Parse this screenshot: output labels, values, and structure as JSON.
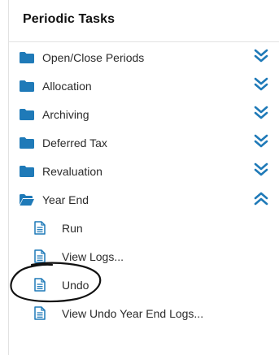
{
  "panel": {
    "title": "Periodic Tasks"
  },
  "colors": {
    "accent": "#1f7ab8",
    "text": "#2b2b2b"
  },
  "tree": {
    "folders": [
      {
        "label": "Open/Close Periods",
        "expanded": false,
        "icon": "folder-icon",
        "chevron": "chevron-double-down-icon"
      },
      {
        "label": "Allocation",
        "expanded": false,
        "icon": "folder-icon",
        "chevron": "chevron-double-down-icon"
      },
      {
        "label": "Archiving",
        "expanded": false,
        "icon": "folder-icon",
        "chevron": "chevron-double-down-icon"
      },
      {
        "label": "Deferred Tax",
        "expanded": false,
        "icon": "folder-icon",
        "chevron": "chevron-double-down-icon"
      },
      {
        "label": "Revaluation",
        "expanded": false,
        "icon": "folder-icon",
        "chevron": "chevron-double-down-icon"
      },
      {
        "label": "Year End",
        "expanded": true,
        "icon": "folder-open-icon",
        "chevron": "chevron-double-up-icon"
      }
    ],
    "year_end_items": [
      {
        "label": "Run",
        "icon": "document-icon"
      },
      {
        "label": "View Logs...",
        "icon": "document-icon"
      },
      {
        "label": "Undo",
        "icon": "document-icon"
      },
      {
        "label": "View Undo Year End Logs...",
        "icon": "document-icon"
      }
    ]
  }
}
